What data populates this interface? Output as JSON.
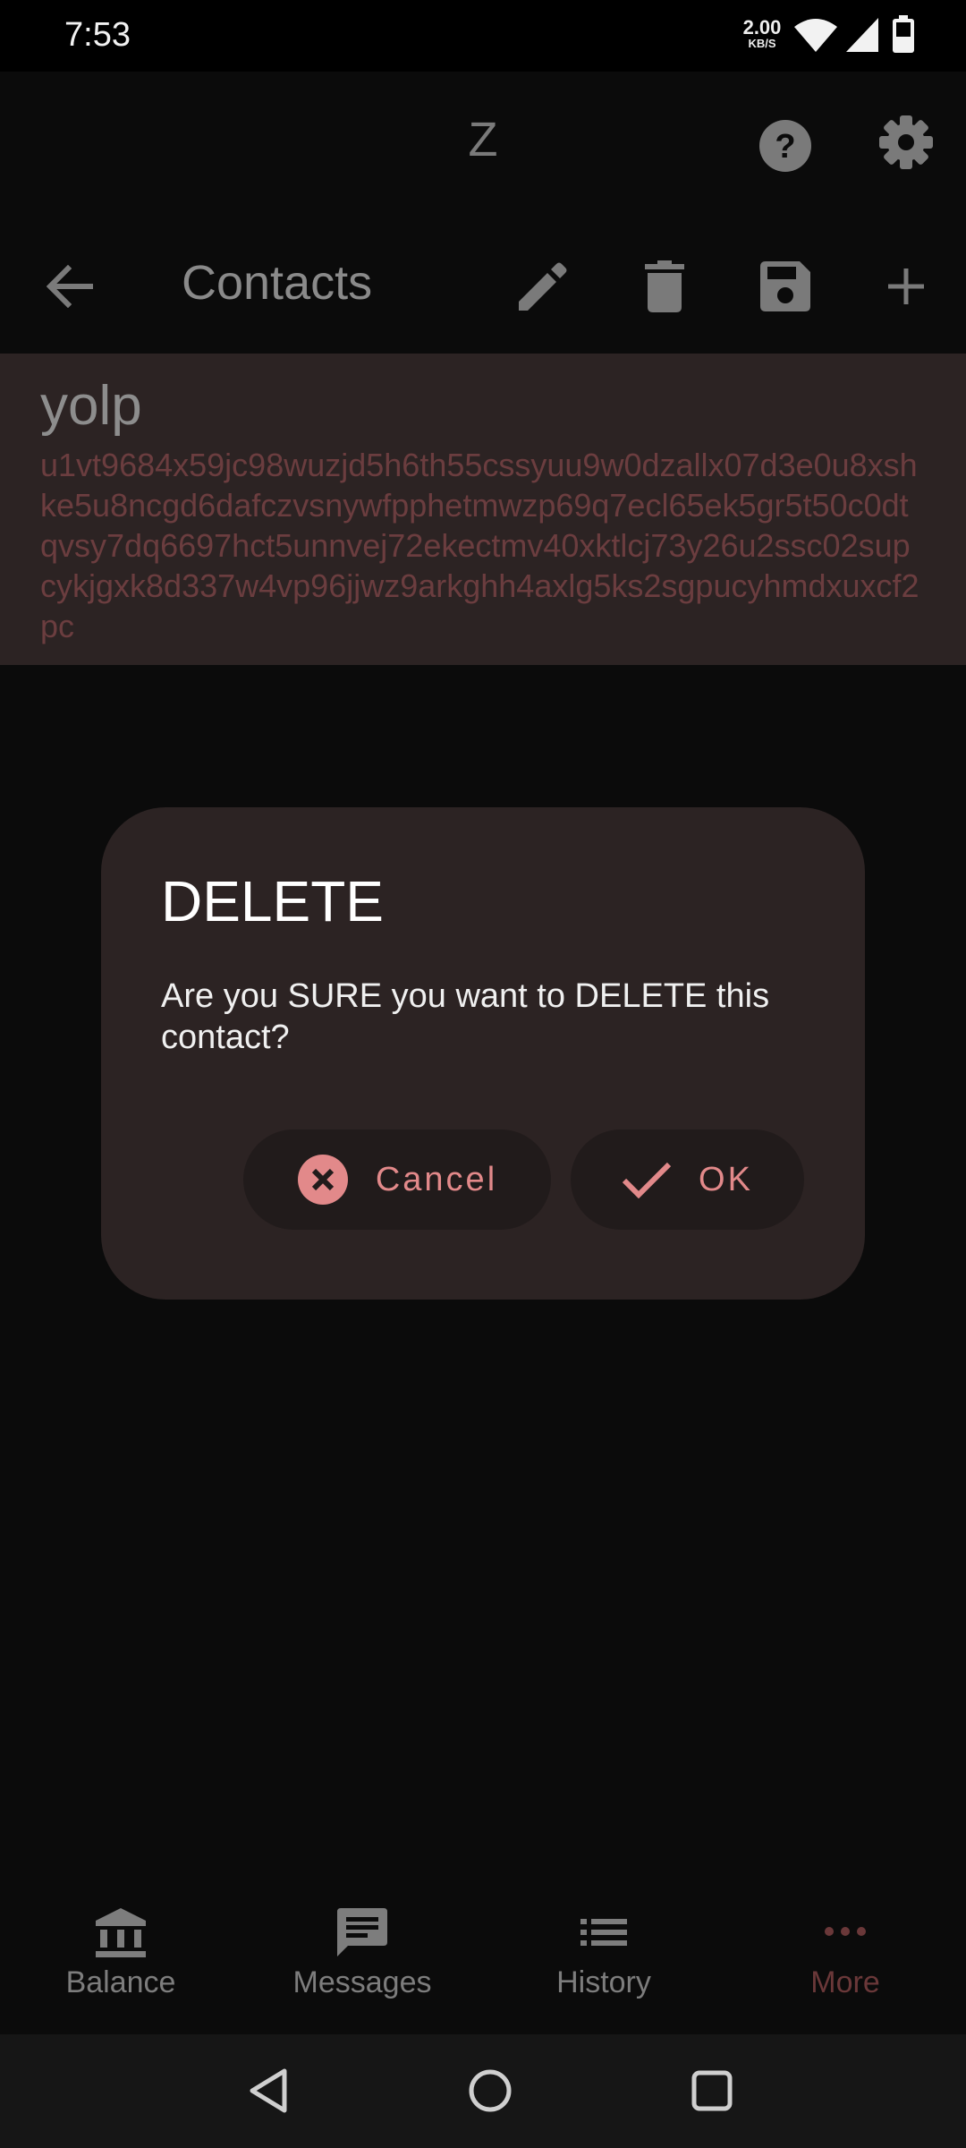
{
  "status_bar": {
    "time": "7:53",
    "net_speed_value": "2.00",
    "net_speed_unit": "KB/S",
    "icons": [
      "wifi-icon",
      "signal-icon",
      "battery-icon"
    ]
  },
  "app_bar": {
    "title": "Z",
    "actions": [
      "help-icon",
      "settings-icon"
    ]
  },
  "contacts_bar": {
    "title": "Contacts",
    "actions": [
      "back-icon",
      "edit-icon",
      "delete-icon",
      "save-icon",
      "add-icon"
    ]
  },
  "contact": {
    "name": "yolp",
    "address": "u1vt9684x59jc98wuzjd5h6th55cssyuu9w0dzallx07d3e0u8xshke5u8ncgd6dafczvsnywfpphetmwzp69q7ecl65ek5gr5t50c0dtqvsy7dq6697hct5unnvej72ekectmv40xktlcj73y26u2ssc02supcykjgxk8d337w4vp96jjwz9arkghh4axlg5ks2sgpucyhmdxuxcf2pc"
  },
  "dialog": {
    "title": "DELETE",
    "message": "Are you SURE you want to DELETE this contact?",
    "cancel_label": "Cancel",
    "ok_label": "OK"
  },
  "bottom_nav": {
    "items": [
      {
        "label": "Balance",
        "icon": "bank-icon"
      },
      {
        "label": "Messages",
        "icon": "message-icon"
      },
      {
        "label": "History",
        "icon": "list-icon"
      },
      {
        "label": "More",
        "icon": "more-icon"
      }
    ]
  },
  "colors": {
    "accent": "#e2898a",
    "dialog_bg": "#2c2323",
    "background": "#0b0b0b"
  }
}
